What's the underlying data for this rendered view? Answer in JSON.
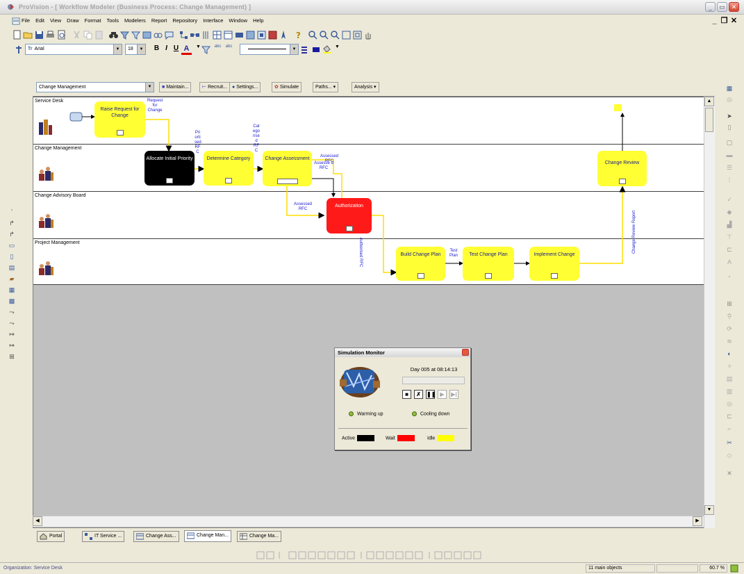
{
  "window": {
    "title": "ProVision - [ Workflow Modeler (Business Process: Change Management) ]"
  },
  "menu": {
    "items": [
      "File",
      "Edit",
      "View",
      "Draw",
      "Format",
      "Tools",
      "Modelers",
      "Report",
      "Repository",
      "Interface",
      "Window",
      "Help"
    ]
  },
  "format_toolbar": {
    "font": "Arial",
    "font_size": "18"
  },
  "diagram_header": {
    "process_select": "Change Management",
    "buttons": [
      "Maintain...",
      "Recruit...",
      "Settings...",
      "Simulate",
      "Paths...",
      "Analysis"
    ]
  },
  "lanes": [
    {
      "title": "Service Desk"
    },
    {
      "title": "Change Management"
    },
    {
      "title": "Change Advisory Board"
    },
    {
      "title": "Project Management"
    }
  ],
  "processes": {
    "raise_request": "Raise Request for Change",
    "allocate_priority": "Allocate Initial Priority",
    "determine_category": "Determine Category",
    "change_assessment": "Change Assessment",
    "authorization": "Authorization",
    "change_review": "Change Review",
    "build_plan": "Build Change Plan",
    "test_plan": "Test Change Plan",
    "implement": "Implement Change"
  },
  "flow_labels": {
    "request_for_change": "Request for Change",
    "prioritised_rfc": "Pri orti sed RF C",
    "categorised_rfc": "Cat ego rise d RF C",
    "assessed_rfc_top": "Assessed RFC",
    "assessed_rfc_overlap": "Assesse d RFC",
    "assessed_rfc_left": "Assessed RFC",
    "authorised_rfc": "Authorised RFC",
    "test_plan": "Test Plan",
    "change_review_report": "Change Review Report"
  },
  "simulation_monitor": {
    "title": "Simulation Monitor",
    "time": "Day 005 at 08:14:13",
    "warming_up": "Warming up",
    "cooling_down": "Cooling down",
    "legend": [
      {
        "label": "Active",
        "color": "#000000"
      },
      {
        "label": "Wait",
        "color": "#ff0000"
      },
      {
        "label": "Idle",
        "color": "#ffff00"
      }
    ]
  },
  "tabs": [
    {
      "label": "Portal"
    },
    {
      "label": "IT Service ..."
    },
    {
      "label": "Change Ass..."
    },
    {
      "label": "Change Man..."
    },
    {
      "label": "Change Ma..."
    }
  ],
  "status": {
    "organization": "Organization: Service Desk",
    "objects": "11 main objects",
    "zoom": "60.7 %"
  }
}
